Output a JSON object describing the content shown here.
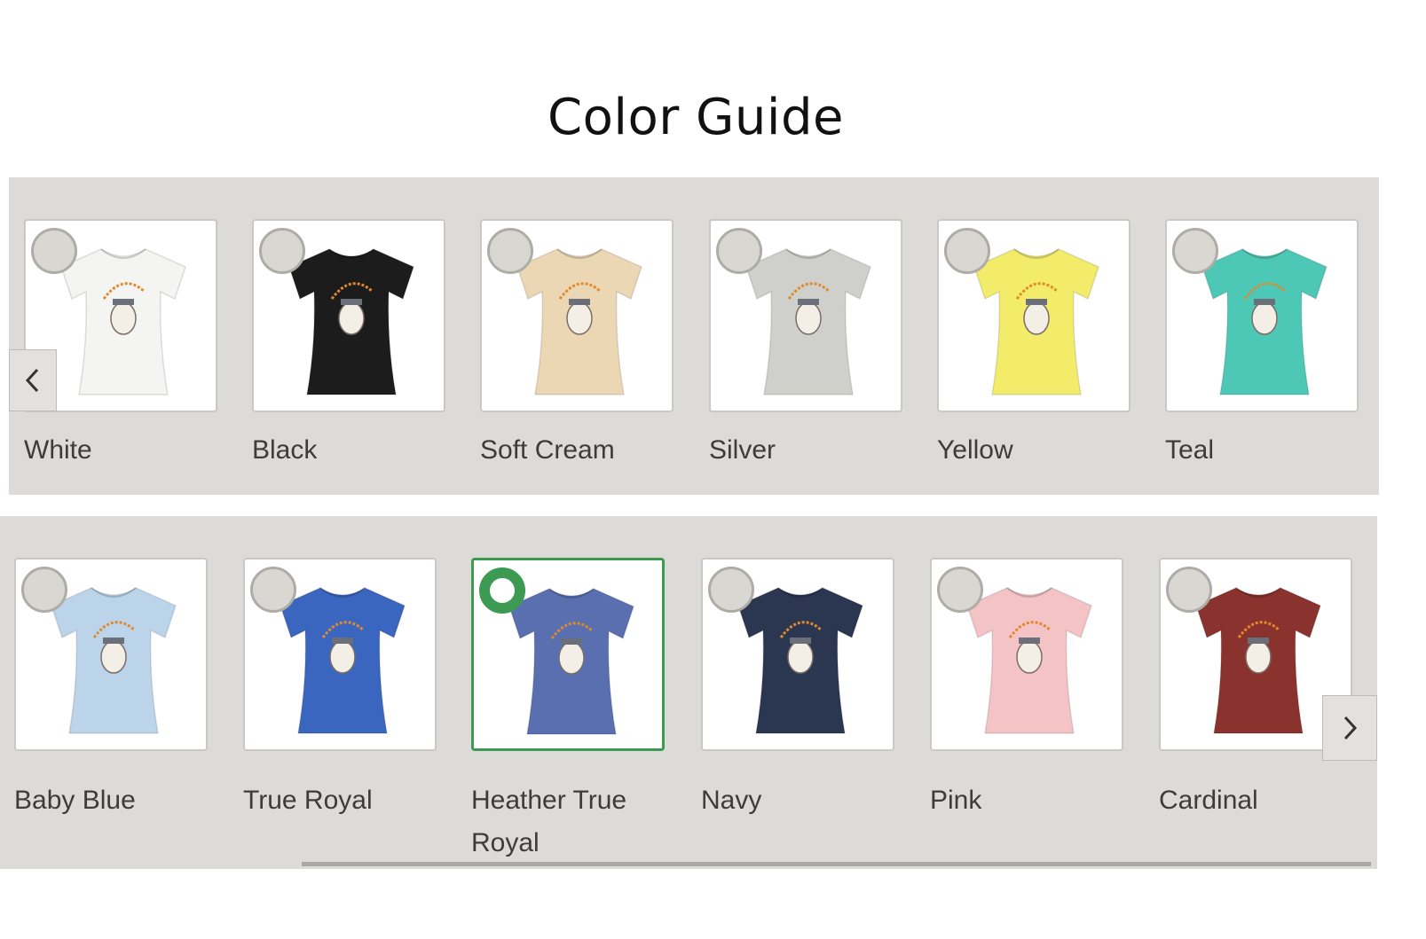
{
  "page": {
    "title": "Color Guide"
  },
  "icons": {
    "radio": "radio-circle-icon",
    "prev": "chevron-left-icon",
    "next": "chevron-right-icon",
    "shirt": "tshirt-icon"
  },
  "colors": {
    "selected_accent": "#3d9a53",
    "panel_bg": "#dcdbd7",
    "print_orange": "#e08a2c"
  },
  "rows": [
    {
      "swatches": [
        {
          "label": "White",
          "color": "#f4f4f2",
          "selected": false
        },
        {
          "label": "Black",
          "color": "#1c1c1c",
          "selected": false
        },
        {
          "label": "Soft Cream",
          "color": "#ecd7b4",
          "selected": false
        },
        {
          "label": "Silver",
          "color": "#cfcfcb",
          "selected": false
        },
        {
          "label": "Yellow",
          "color": "#f2ec6a",
          "selected": false
        },
        {
          "label": "Teal",
          "color": "#4dc8b6",
          "selected": false
        }
      ]
    },
    {
      "swatches": [
        {
          "label": "Baby Blue",
          "color": "#bcd4ea",
          "selected": false
        },
        {
          "label": "True Royal",
          "color": "#3b66bf",
          "selected": false
        },
        {
          "label": "Heather True Royal",
          "label_line1": "Heather True",
          "label_line2": "Royal",
          "color": "#5a6fb0",
          "selected": true
        },
        {
          "label": "Navy",
          "color": "#2b3650",
          "selected": false
        },
        {
          "label": "Pink",
          "color": "#f4c3c6",
          "selected": false
        },
        {
          "label": "Cardinal",
          "color": "#8a332e",
          "selected": false
        }
      ]
    }
  ]
}
